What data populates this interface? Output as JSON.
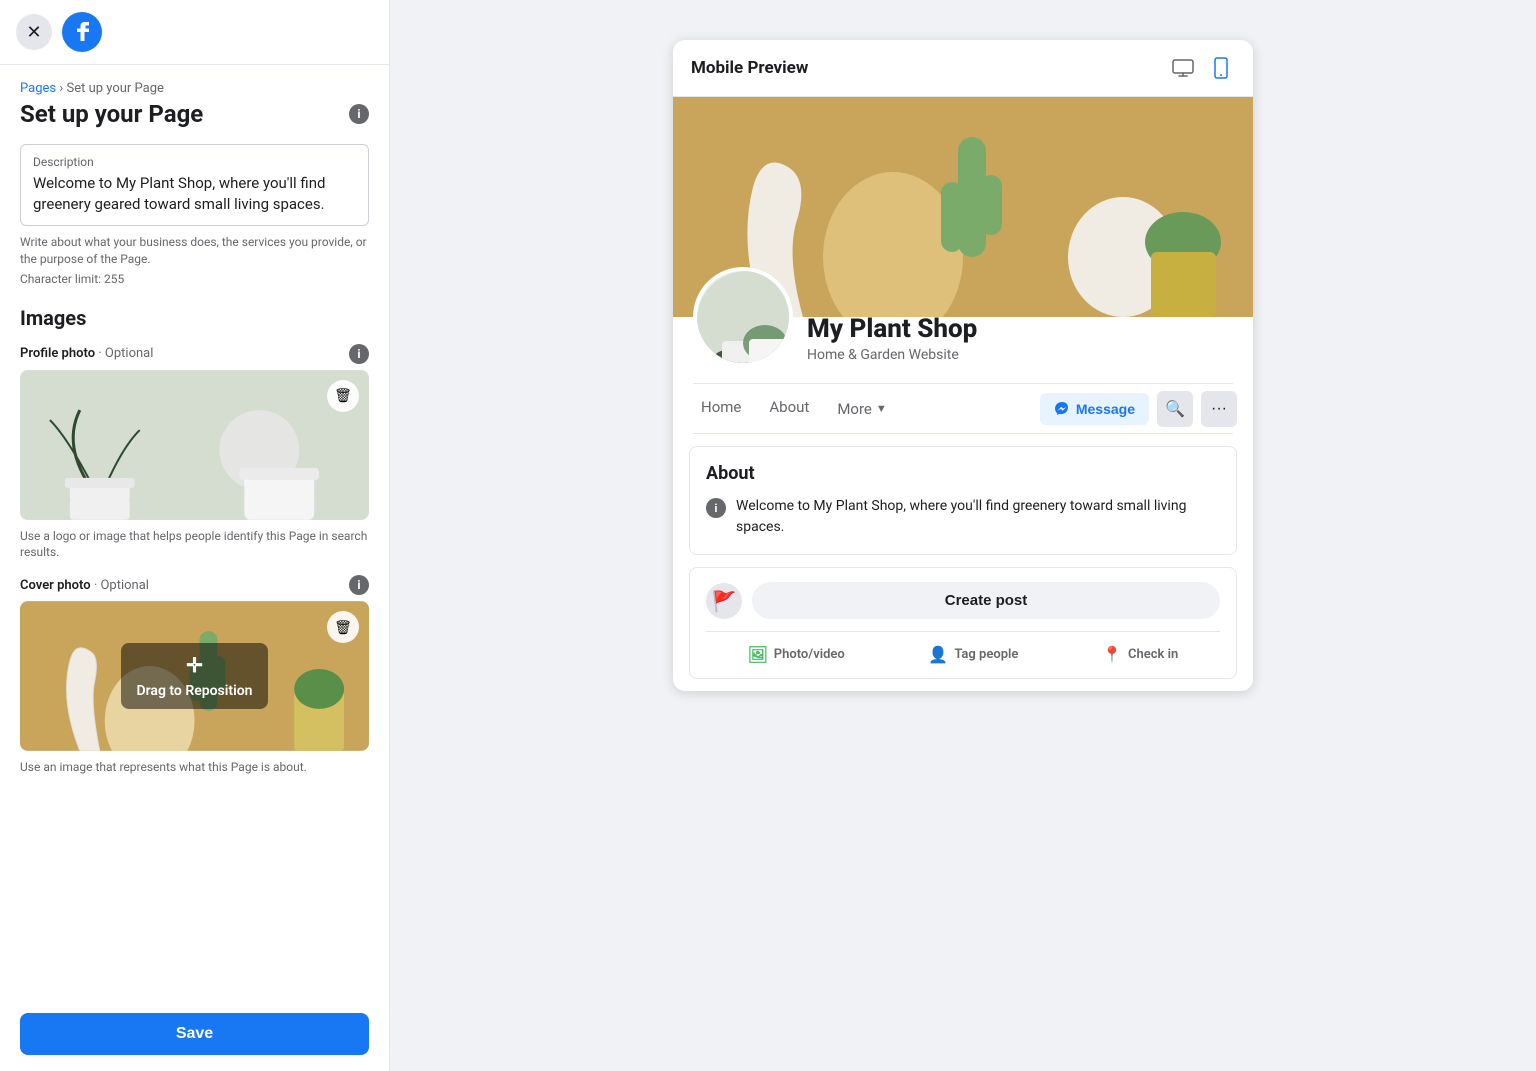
{
  "topBar": {
    "close_label": "×",
    "fb_logo_alt": "Facebook"
  },
  "leftPanel": {
    "breadcrumb": {
      "pages_label": "Pages",
      "separator": " › ",
      "current": "Set up your Page"
    },
    "page_title": "Set up your Page",
    "info_icon": "i",
    "description": {
      "label": "Description",
      "value": "Welcome to My Plant Shop, where you'll find greenery geared toward small living spaces.",
      "helper": "Write about what your business does, the services you provide, or the purpose of the Page.",
      "char_limit": "Character limit: 255"
    },
    "images_section": {
      "title": "Images",
      "profile_photo": {
        "label": "Profile photo",
        "optional": "· Optional"
      },
      "profile_helper": "Use a logo or image that helps people identify this Page in search results.",
      "cover_photo": {
        "label": "Cover photo",
        "optional": "· Optional"
      },
      "cover_helper": "Use an image that represents what this Page is about.",
      "drag_reposition": "Drag to Reposition"
    },
    "save_button": "Save"
  },
  "rightPanel": {
    "preview_title": "Mobile Preview",
    "desktop_icon": "🖥",
    "mobile_icon": "📱",
    "page_name": "My Plant Shop",
    "page_category": "Home & Garden Website",
    "nav": {
      "home": "Home",
      "about": "About",
      "more": "More",
      "message": "Message"
    },
    "about_section": {
      "title": "About",
      "text": "Welcome to My Plant Shop, where you'll find greenery toward small living spaces."
    },
    "post_section": {
      "create_label": "Create post",
      "photo_video": "Photo/video",
      "tag_people": "Tag people",
      "check_in": "Check in"
    }
  }
}
